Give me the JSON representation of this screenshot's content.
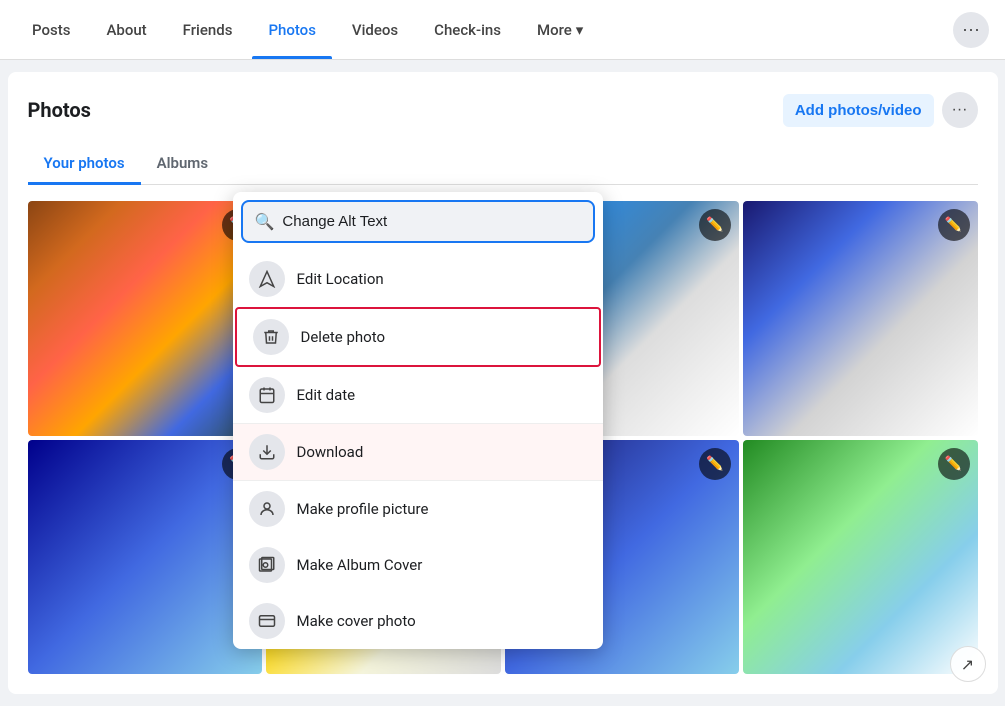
{
  "nav": {
    "items": [
      {
        "label": "Posts",
        "active": false
      },
      {
        "label": "About",
        "active": false
      },
      {
        "label": "Friends",
        "active": false
      },
      {
        "label": "Photos",
        "active": true
      },
      {
        "label": "Videos",
        "active": false
      },
      {
        "label": "Check-ins",
        "active": false
      },
      {
        "label": "More",
        "active": false,
        "hasChevron": true
      }
    ],
    "more_btn_label": "···"
  },
  "section": {
    "title": "Photos",
    "add_photos_label": "Add photos/video",
    "more_btn_label": "···"
  },
  "tabs": [
    {
      "label": "Your photos",
      "active": true
    },
    {
      "label": "Albums",
      "active": false
    }
  ],
  "dropdown": {
    "search_placeholder": "Change Alt Text",
    "items": [
      {
        "id": "change-alt-text",
        "label": "Change Alt Text",
        "icon": "search"
      },
      {
        "id": "edit-location",
        "label": "Edit Location",
        "icon": "location"
      },
      {
        "id": "delete-photo",
        "label": "Delete photo",
        "icon": "trash",
        "highlighted": true
      },
      {
        "id": "edit-date",
        "label": "Edit date",
        "icon": "calendar"
      },
      {
        "id": "download",
        "label": "Download",
        "icon": "download",
        "download_highlighted": true
      },
      {
        "id": "make-profile-picture",
        "label": "Make profile picture",
        "icon": "profile"
      },
      {
        "id": "make-album-cover",
        "label": "Make Album Cover",
        "icon": "album"
      },
      {
        "id": "make-cover-photo",
        "label": "Make cover photo",
        "icon": "cover"
      }
    ]
  },
  "photos": [
    {
      "id": 1,
      "class": "photo-1"
    },
    {
      "id": 2,
      "class": "photo-2"
    },
    {
      "id": 3,
      "class": "photo-3"
    },
    {
      "id": 4,
      "class": "photo-4"
    },
    {
      "id": 5,
      "class": "photo-5"
    },
    {
      "id": 6,
      "class": "photo-6"
    },
    {
      "id": 7,
      "class": "photo-7"
    },
    {
      "id": 8,
      "class": "photo-8"
    }
  ]
}
